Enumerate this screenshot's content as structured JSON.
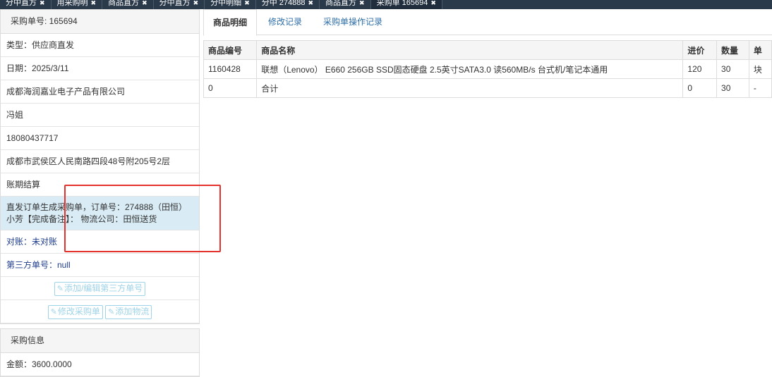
{
  "top_tabs": [
    {
      "label": "分中直方",
      "active": false
    },
    {
      "label": "用采购明",
      "active": false
    },
    {
      "label": "商品直方",
      "active": false
    },
    {
      "label": "分中直方",
      "active": false
    },
    {
      "label": "分中明细",
      "active": false
    },
    {
      "label": "分中 274888",
      "active": false
    },
    {
      "label": "商品直方",
      "active": false
    },
    {
      "label": "采购单 165694",
      "active": true
    }
  ],
  "order_panel": {
    "header": "采购单号: 165694",
    "type": "类型：供应商直发",
    "date": "日期：2025/3/11",
    "supplier": "成都海润嘉业电子产品有限公司",
    "contact": "冯姐",
    "phone": "18080437717",
    "address": "成都市武侯区人民南路四段48号附205号2层",
    "payment": "账期结算",
    "note": "直发订单生成采购单，订单号：274888（田恒）小芳【完成备注】：  物流公司：田恒送货",
    "reconcile": "对账：未对账",
    "third_party": "第三方单号：null",
    "btn_third_party": "添加/编辑第三方单号",
    "btn_edit_order": "修改采购单",
    "btn_add_logistics": "添加物流"
  },
  "purchase_info": {
    "header": "采购信息",
    "amount": "金额：3600.0000"
  },
  "detail_tabs": [
    {
      "label": "商品明细",
      "active": true
    },
    {
      "label": "修改记录",
      "active": false
    },
    {
      "label": "采购单操作记录",
      "active": false
    }
  ],
  "table": {
    "headers": [
      "商品编号",
      "商品名称",
      "进价",
      "数量",
      "单"
    ],
    "rows": [
      [
        "1160428",
        "联想（Lenovo） E660 256GB SSD固态硬盘 2.5英寸SATA3.0 读560MB/s 台式机/笔记本通用",
        "120",
        "30",
        "块"
      ],
      [
        "0",
        "合计",
        "0",
        "30",
        "-"
      ]
    ]
  },
  "colors": {
    "highlight": "#e5312c",
    "link": "#2f6fa7",
    "topbar": "#2b3a4a"
  },
  "icons": {
    "edit": "edit-icon",
    "close": "close-icon"
  }
}
